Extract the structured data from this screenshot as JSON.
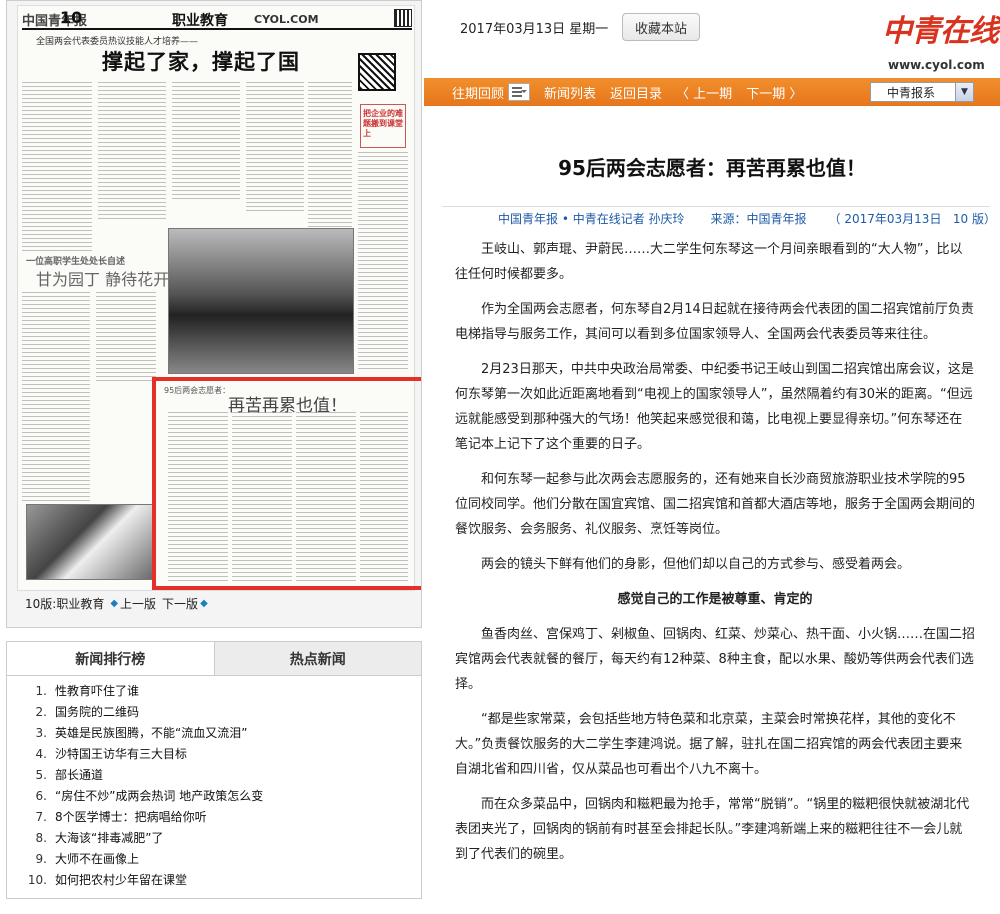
{
  "paper_thumbnail": {
    "masthead": {
      "logo": "中国青年报",
      "page_number": "10",
      "section": "职业教育",
      "site": "CYOL.COM"
    },
    "kicker": "全国两会代表委员热议技能人才培养——",
    "headline": "撑起了家，撑起了国",
    "side_box_title": "把企业的难题搬到课堂上",
    "subhead_1": "一位高职学生处处长自述",
    "subhead_2": "甘为园丁 静待花开",
    "highlighted_story": {
      "kicker": "95后两会志愿者：",
      "title": "再苦再累也值！"
    },
    "page_nav": {
      "current_page": "10版:职业教育",
      "prev_label": "上一版",
      "next_label": "下一版"
    }
  },
  "rank_panel": {
    "tabs": [
      "新闻排行榜",
      "热点新闻"
    ],
    "items": [
      {
        "num": "1.",
        "title": "性教育吓住了谁"
      },
      {
        "num": "2.",
        "title": "国务院的二维码"
      },
      {
        "num": "3.",
        "title": "英雄是民族图腾，不能“流血又流泪”"
      },
      {
        "num": "4.",
        "title": "沙特国王访华有三大目标"
      },
      {
        "num": "5.",
        "title": "部长通道"
      },
      {
        "num": "6.",
        "title": "“房住不炒”成两会热词 地产政策怎么变"
      },
      {
        "num": "7.",
        "title": "8个医学博士：把病唱给你听"
      },
      {
        "num": "8.",
        "title": "大海该“排毒减肥”了"
      },
      {
        "num": "9.",
        "title": "大师不在画像上"
      },
      {
        "num": "10.",
        "title": "如何把农村少年留在课堂"
      }
    ]
  },
  "header": {
    "date": "2017年03月13日 星期一",
    "favorite_button": "收藏本站",
    "logo": "中青在线",
    "logo_url": "www.cyol.com"
  },
  "navbar": {
    "archive": "往期回顾",
    "news_list": "新闻列表",
    "back_to_index": "返回目录",
    "prev_page": "〈 上一期",
    "next_page": "下一期 〉",
    "paper_select": "中青报系"
  },
  "article": {
    "title": "95后两会志愿者：再苦再累也值！",
    "byline_source": "中国青年报 • 中青在线记者 孙庆玲",
    "byline_origin": "来源：中国青年报",
    "byline_date": "（ 2017年03月13日   10 版）",
    "paragraphs": [
      "王岐山、郭声琨、尹蔚民……大二学生何东琴这一个月间亲眼看到的“大人物”，比以往任何时候都要多。",
      "作为全国两会志愿者，何东琴自2月14日起就在接待两会代表团的国二招宾馆前厅负责电梯指导与服务工作，其间可以看到多位国家领导人、全国两会代表委员等来往往。",
      "2月23日那天，中共中央政治局常委、中纪委书记王岐山到国二招宾馆出席会议，这是何东琴第一次如此近距离地看到“电视上的国家领导人”，虽然隔着约有30米的距离。“但远远就能感受到那种强大的气场！他笑起来感觉很和蔼，比电视上要显得亲切。”何东琴还在笔记本上记下了这个重要的日子。",
      "和何东琴一起参与此次两会志愿服务的，还有她来自长沙商贸旅游职业技术学院的95位同校同学。他们分散在国宜宾馆、国二招宾馆和首都大酒店等地，服务于全国两会期间的餐饮服务、会务服务、礼仪服务、烹饪等岗位。",
      "两会的镜头下鲜有他们的身影，但他们却以自己的方式参与、感受着两会。"
    ],
    "subheading": "感觉自己的工作是被尊重、肯定的",
    "paragraphs_2": [
      "鱼香肉丝、宫保鸡丁、剁椒鱼、回锅肉、红菜、炒菜心、热干面、小火锅……在国二招宾馆两会代表就餐的餐厅，每天约有12种菜、8种主食，配以水果、酸奶等供两会代表们选择。",
      "“都是些家常菜，会包括些地方特色菜和北京菜，主菜会时常换花样，其他的变化不大。”负责餐饮服务的大二学生李建鸿说。据了解，驻扎在国二招宾馆的两会代表团主要来自湖北省和四川省，仅从菜品也可看出个八九不离十。",
      "而在众多菜品中，回锅肉和糍粑最为抢手，常常“脱销”。“锅里的糍粑很快就被湖北代表团夹光了，回锅肉的锅前有时甚至会排起长队。”李建鸿新端上来的糍粑往往不一会儿就到了代表们的碗里。"
    ]
  }
}
